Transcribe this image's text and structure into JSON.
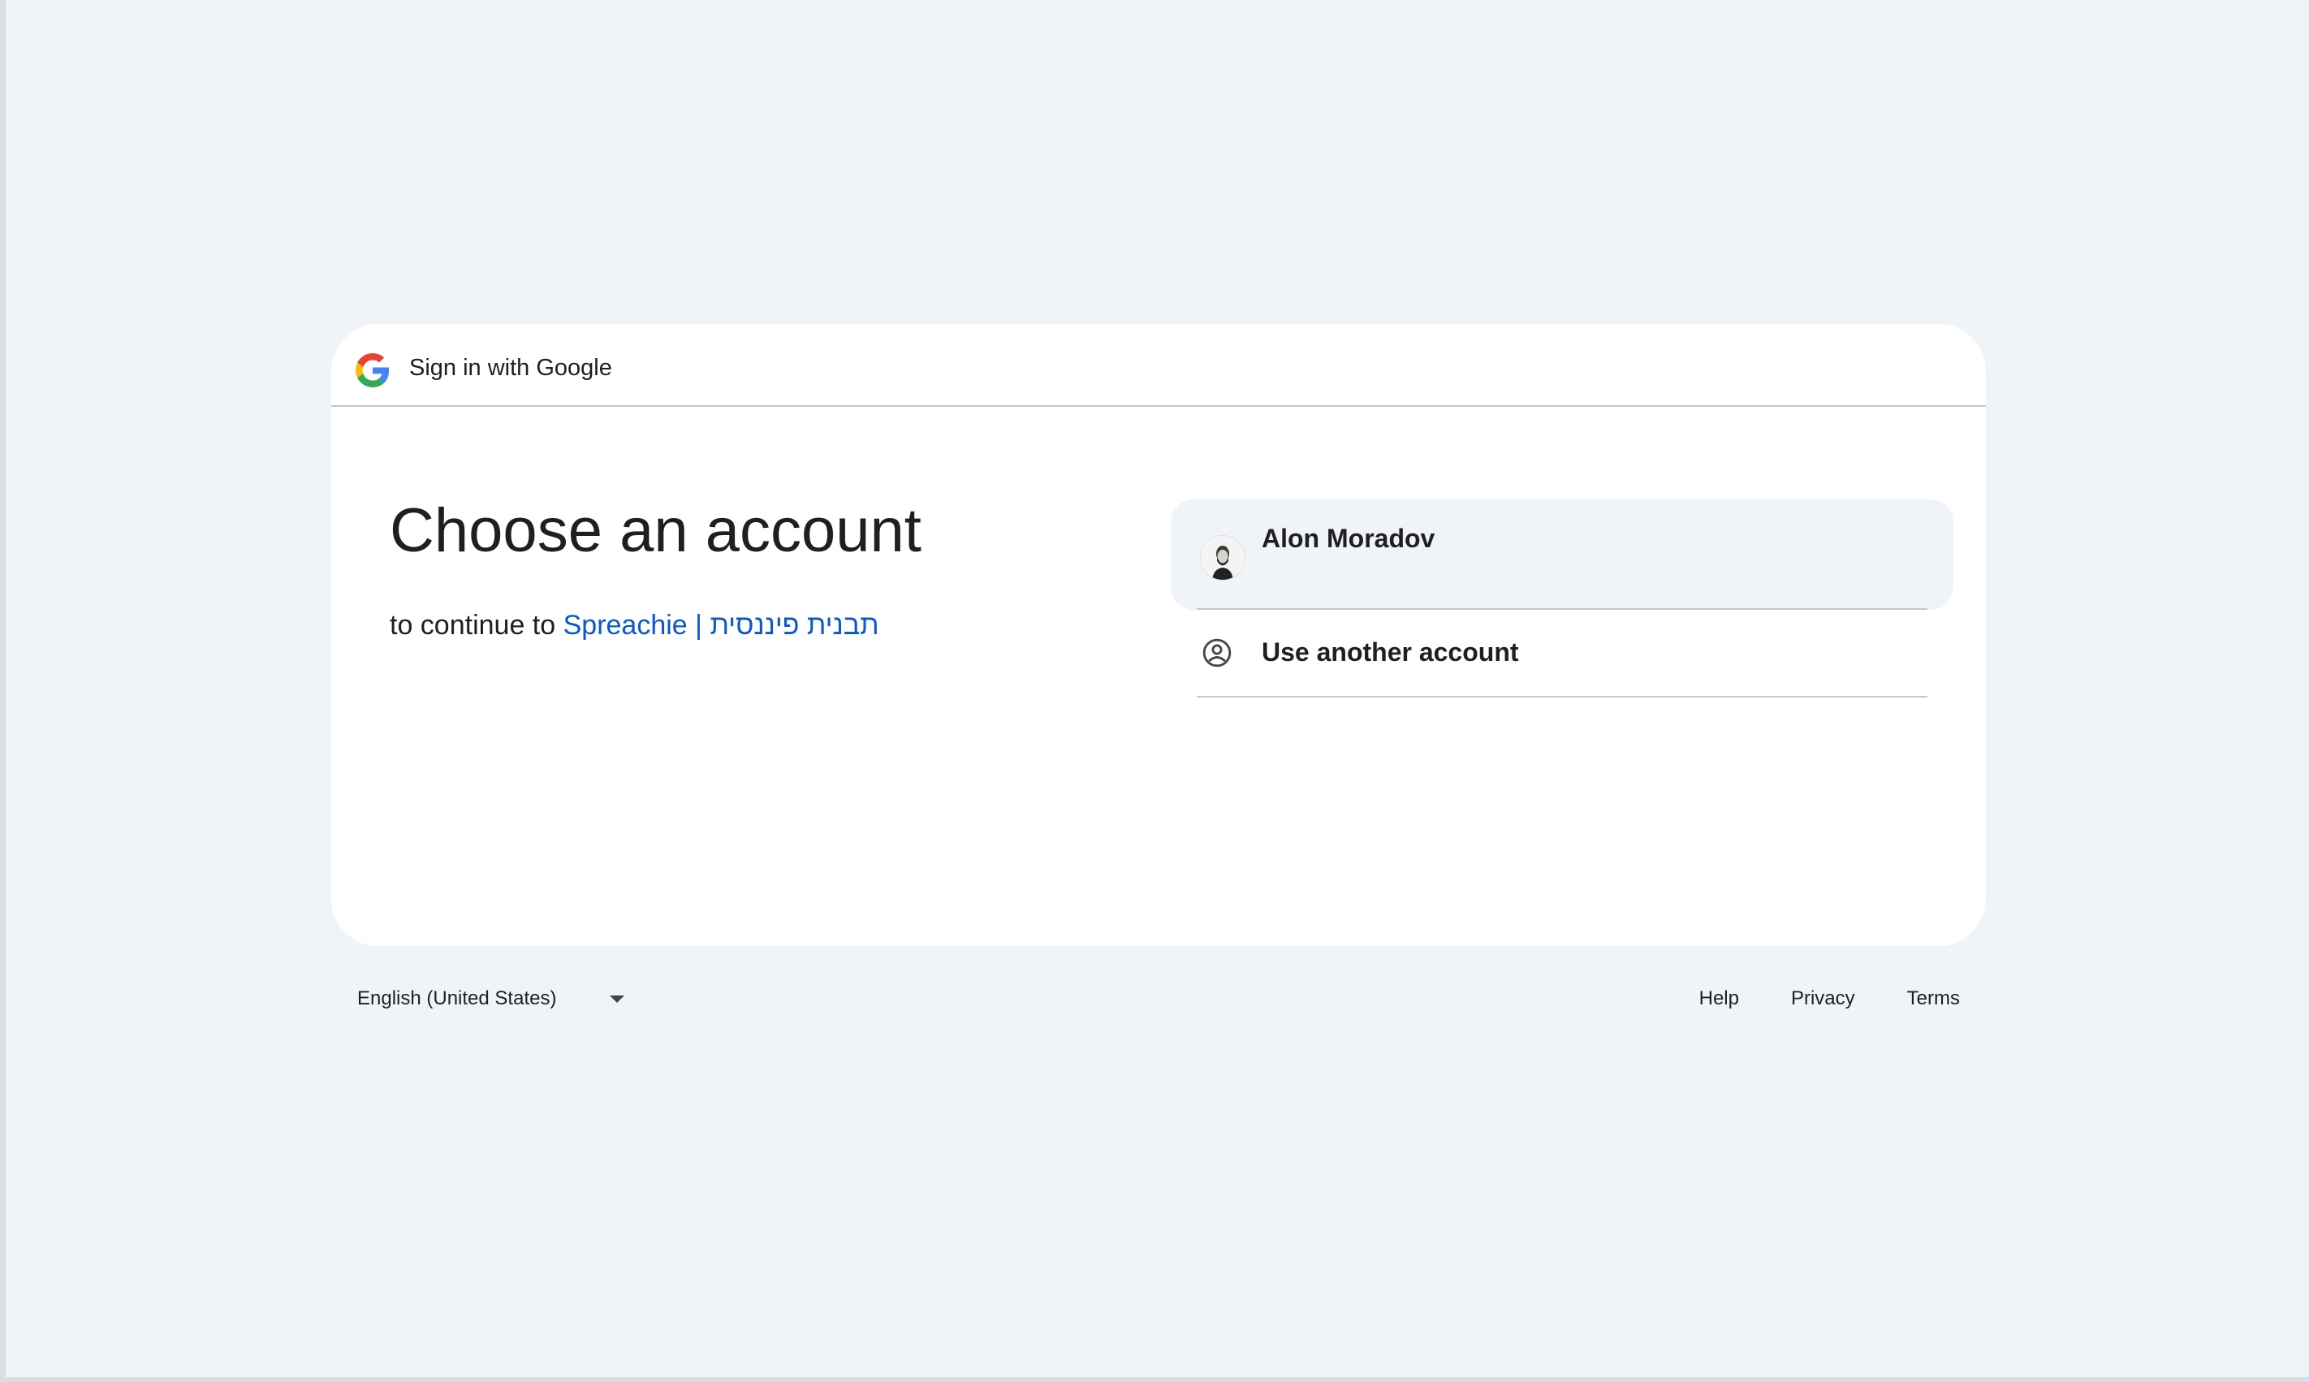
{
  "header": {
    "title": "Sign in with Google"
  },
  "main": {
    "heading": "Choose an account",
    "subtitle_prefix": "to continue to",
    "app_name": "Spreachie | תבנית פיננסית"
  },
  "accounts": [
    {
      "name": "Alon Moradov",
      "avatar_icon": "user-photo-avatar"
    }
  ],
  "use_another": {
    "label": "Use another account",
    "icon": "account-circle-icon"
  },
  "footer": {
    "language": "English (United States)",
    "links": [
      "Help",
      "Privacy",
      "Terms"
    ]
  },
  "colors": {
    "background": "#f0f4f9",
    "card": "#ffffff",
    "link": "#0b57d0",
    "text": "#1f1f1f",
    "divider": "#c4c7c5"
  }
}
